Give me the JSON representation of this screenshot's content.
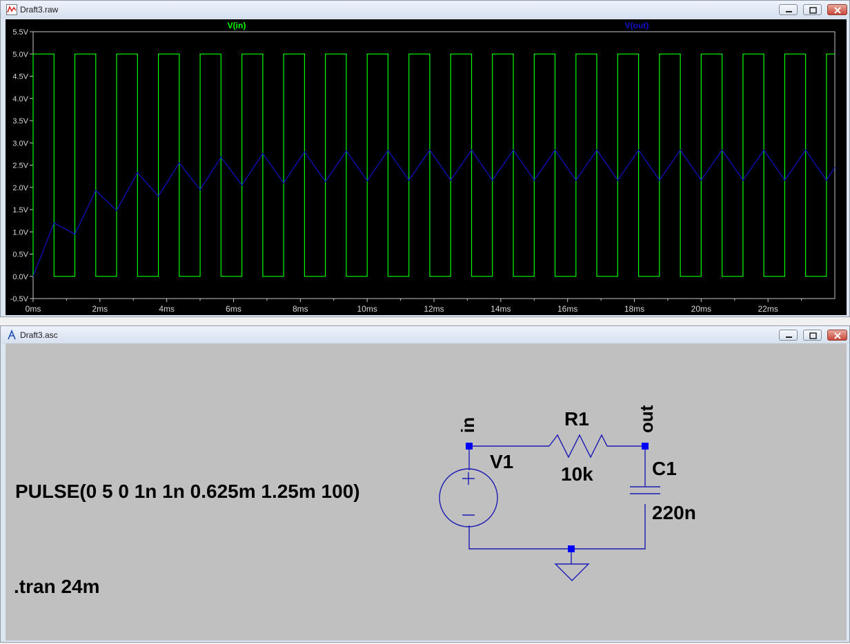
{
  "plot_window": {
    "title": "Draft3.raw",
    "icon": "waveform-icon"
  },
  "schematic_window": {
    "title": "Draft3.asc",
    "icon": "ltspice-icon"
  },
  "chart_data": {
    "type": "line",
    "xlabel": "",
    "ylabel": "",
    "xlim": [
      0,
      24
    ],
    "ylim": [
      -0.5,
      5.5
    ],
    "grid": false,
    "x_ticks": [
      "0ms",
      "2ms",
      "4ms",
      "6ms",
      "8ms",
      "10ms",
      "12ms",
      "14ms",
      "16ms",
      "18ms",
      "20ms",
      "22ms"
    ],
    "y_ticks": [
      "5.5V",
      "5.0V",
      "4.5V",
      "4.0V",
      "3.5V",
      "3.0V",
      "2.5V",
      "2.0V",
      "1.5V",
      "1.0V",
      "0.5V",
      "0.0V",
      "-0.5V"
    ],
    "series": [
      {
        "name": "V(in)",
        "color": "#00ff00",
        "x_unit": "ms",
        "description": "square pulse 0–5V, period 1.25ms, 50% duty",
        "x": [
          0,
          0,
          0.625,
          0.625,
          1.25,
          1.25,
          1.875,
          1.875,
          2.5,
          2.5,
          3.125,
          3.125,
          3.75,
          3.75,
          4.375,
          4.375,
          5,
          5,
          5.625,
          5.625,
          6.25,
          6.25,
          6.875,
          6.875,
          7.5,
          7.5,
          8.125,
          8.125,
          8.75,
          8.75,
          9.375,
          9.375,
          10,
          10,
          10.625,
          10.625,
          11.25,
          11.25,
          11.875,
          11.875,
          12.5,
          12.5,
          13.125,
          13.125,
          13.75,
          13.75,
          14.375,
          14.375,
          15,
          15,
          15.625,
          15.625,
          16.25,
          16.25,
          16.875,
          16.875,
          17.5,
          17.5,
          18.125,
          18.125,
          18.75,
          18.75,
          19.375,
          19.375,
          20,
          20,
          20.625,
          20.625,
          21.25,
          21.25,
          21.875,
          21.875,
          22.5,
          22.5,
          23.125,
          23.125,
          23.75,
          23.75,
          24
        ],
        "y": [
          0,
          5,
          5,
          0,
          0,
          5,
          5,
          0,
          0,
          5,
          5,
          0,
          0,
          5,
          5,
          0,
          0,
          5,
          5,
          0,
          0,
          5,
          5,
          0,
          0,
          5,
          5,
          0,
          0,
          5,
          5,
          0,
          0,
          5,
          5,
          0,
          0,
          5,
          5,
          0,
          0,
          5,
          5,
          0,
          0,
          5,
          5,
          0,
          0,
          5,
          5,
          0,
          0,
          5,
          5,
          0,
          0,
          5,
          5,
          0,
          0,
          5,
          5,
          0,
          0,
          5,
          5,
          0,
          0,
          5,
          5,
          0,
          0,
          5,
          5,
          0,
          0,
          5,
          5
        ]
      },
      {
        "name": "V(out)",
        "color": "#1010c8",
        "x_unit": "ms",
        "x": [
          0,
          0.625,
          1.25,
          1.875,
          2.5,
          3.125,
          3.75,
          4.375,
          5,
          5.625,
          6.25,
          6.875,
          7.5,
          8.125,
          8.75,
          9.375,
          10,
          10.625,
          11.25,
          11.875,
          12.5,
          13.125,
          13.75,
          14.375,
          15,
          15.625,
          16.25,
          16.875,
          17.5,
          18.125,
          18.75,
          19.375,
          20,
          20.625,
          21.25,
          21.875,
          22.5,
          23.125,
          23.75,
          24
        ],
        "y": [
          0,
          1.2,
          0.95,
          1.93,
          1.48,
          2.33,
          1.8,
          2.55,
          1.95,
          2.68,
          2.05,
          2.76,
          2.1,
          2.8,
          2.13,
          2.82,
          2.15,
          2.83,
          2.16,
          2.84,
          2.16,
          2.84,
          2.16,
          2.84,
          2.16,
          2.84,
          2.16,
          2.84,
          2.16,
          2.84,
          2.16,
          2.84,
          2.16,
          2.84,
          2.16,
          2.84,
          2.16,
          2.84,
          2.16,
          2.45
        ]
      }
    ]
  },
  "schematic": {
    "net_in": "in",
    "net_out": "out",
    "resistor_name": "R1",
    "resistor_value": "10k",
    "source_name": "V1",
    "cap_name": "C1",
    "cap_value": "220n",
    "pulse_directive": "PULSE(0 5 0 1n 1n 0.625m 1.25m 100)",
    "tran_directive": ".tran 24m"
  }
}
